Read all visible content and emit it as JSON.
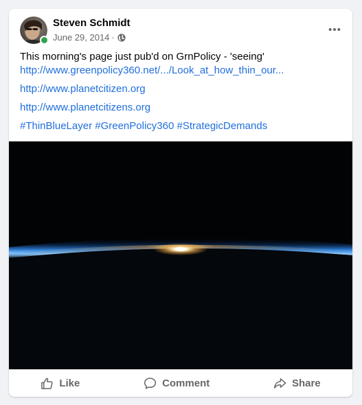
{
  "post": {
    "author": {
      "name": "Steven Schmidt",
      "online": true,
      "online_color": "#31a24c"
    },
    "date": "June 29, 2014",
    "separator": "·",
    "audience_icon": "globe-icon",
    "menu_icon": "more-dots-icon",
    "text_line1": "This morning's page just pub'd on GrnPolicy - 'seeing'",
    "link1": "http://www.greenpolicy360.net/.../Look_at_how_thin_our...",
    "link2": "http://www.planetcitizen.org",
    "link3": "http://www.planetcitizens.org",
    "hashtags": "#ThinBlueLayer #GreenPolicy360 #StrategicDemands",
    "link_color": "#216fdb",
    "image_description_icon": "earth-horizon-photo"
  },
  "actions": {
    "like": {
      "label": "Like",
      "icon": "thumbs-up-icon"
    },
    "comment": {
      "label": "Comment",
      "icon": "comment-icon"
    },
    "share": {
      "label": "Share",
      "icon": "share-icon"
    }
  }
}
